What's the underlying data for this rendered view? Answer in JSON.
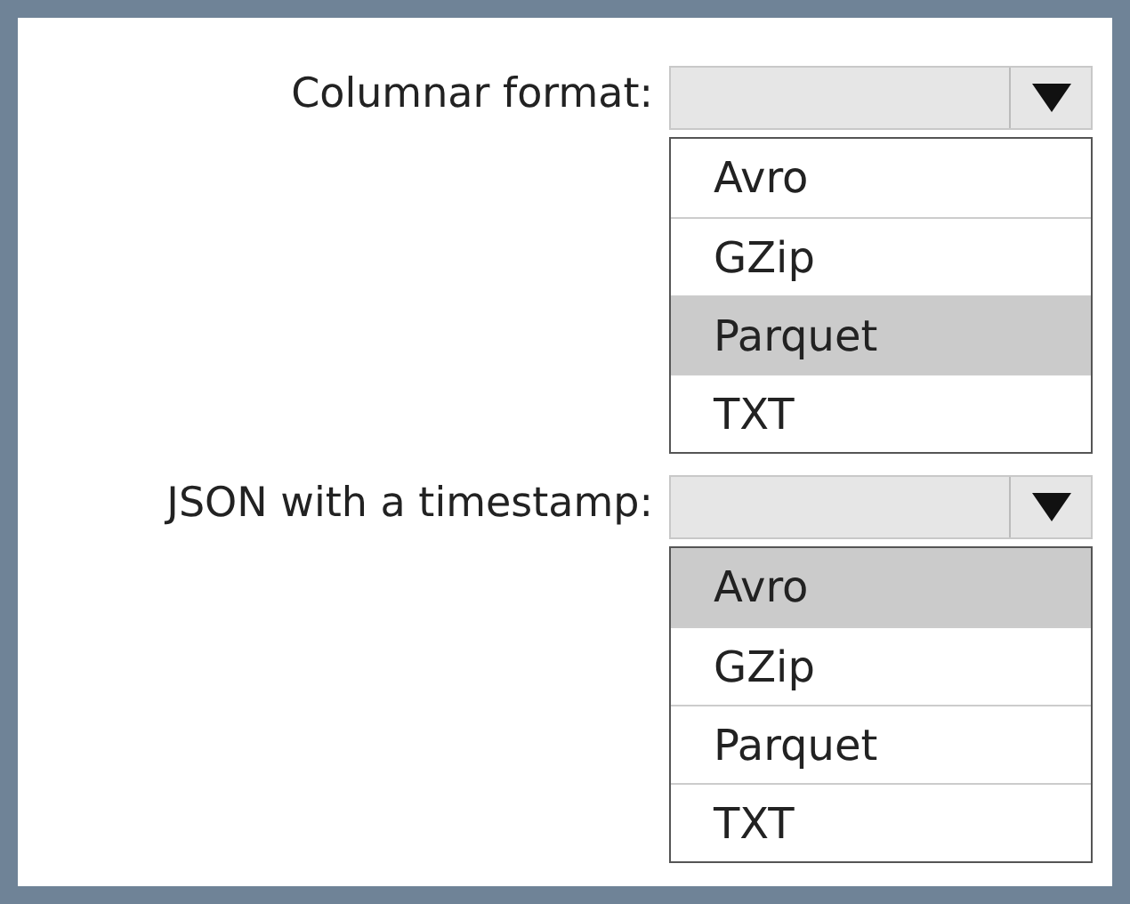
{
  "dropdowns": [
    {
      "label": "Columnar format:",
      "options": [
        {
          "label": "Avro",
          "selected": false
        },
        {
          "label": "GZip",
          "selected": false
        },
        {
          "label": "Parquet",
          "selected": true
        },
        {
          "label": "TXT",
          "selected": false
        }
      ]
    },
    {
      "label": "JSON with a timestamp:",
      "options": [
        {
          "label": "Avro",
          "selected": true
        },
        {
          "label": "GZip",
          "selected": false
        },
        {
          "label": "Parquet",
          "selected": false
        },
        {
          "label": "TXT",
          "selected": false
        }
      ]
    }
  ]
}
